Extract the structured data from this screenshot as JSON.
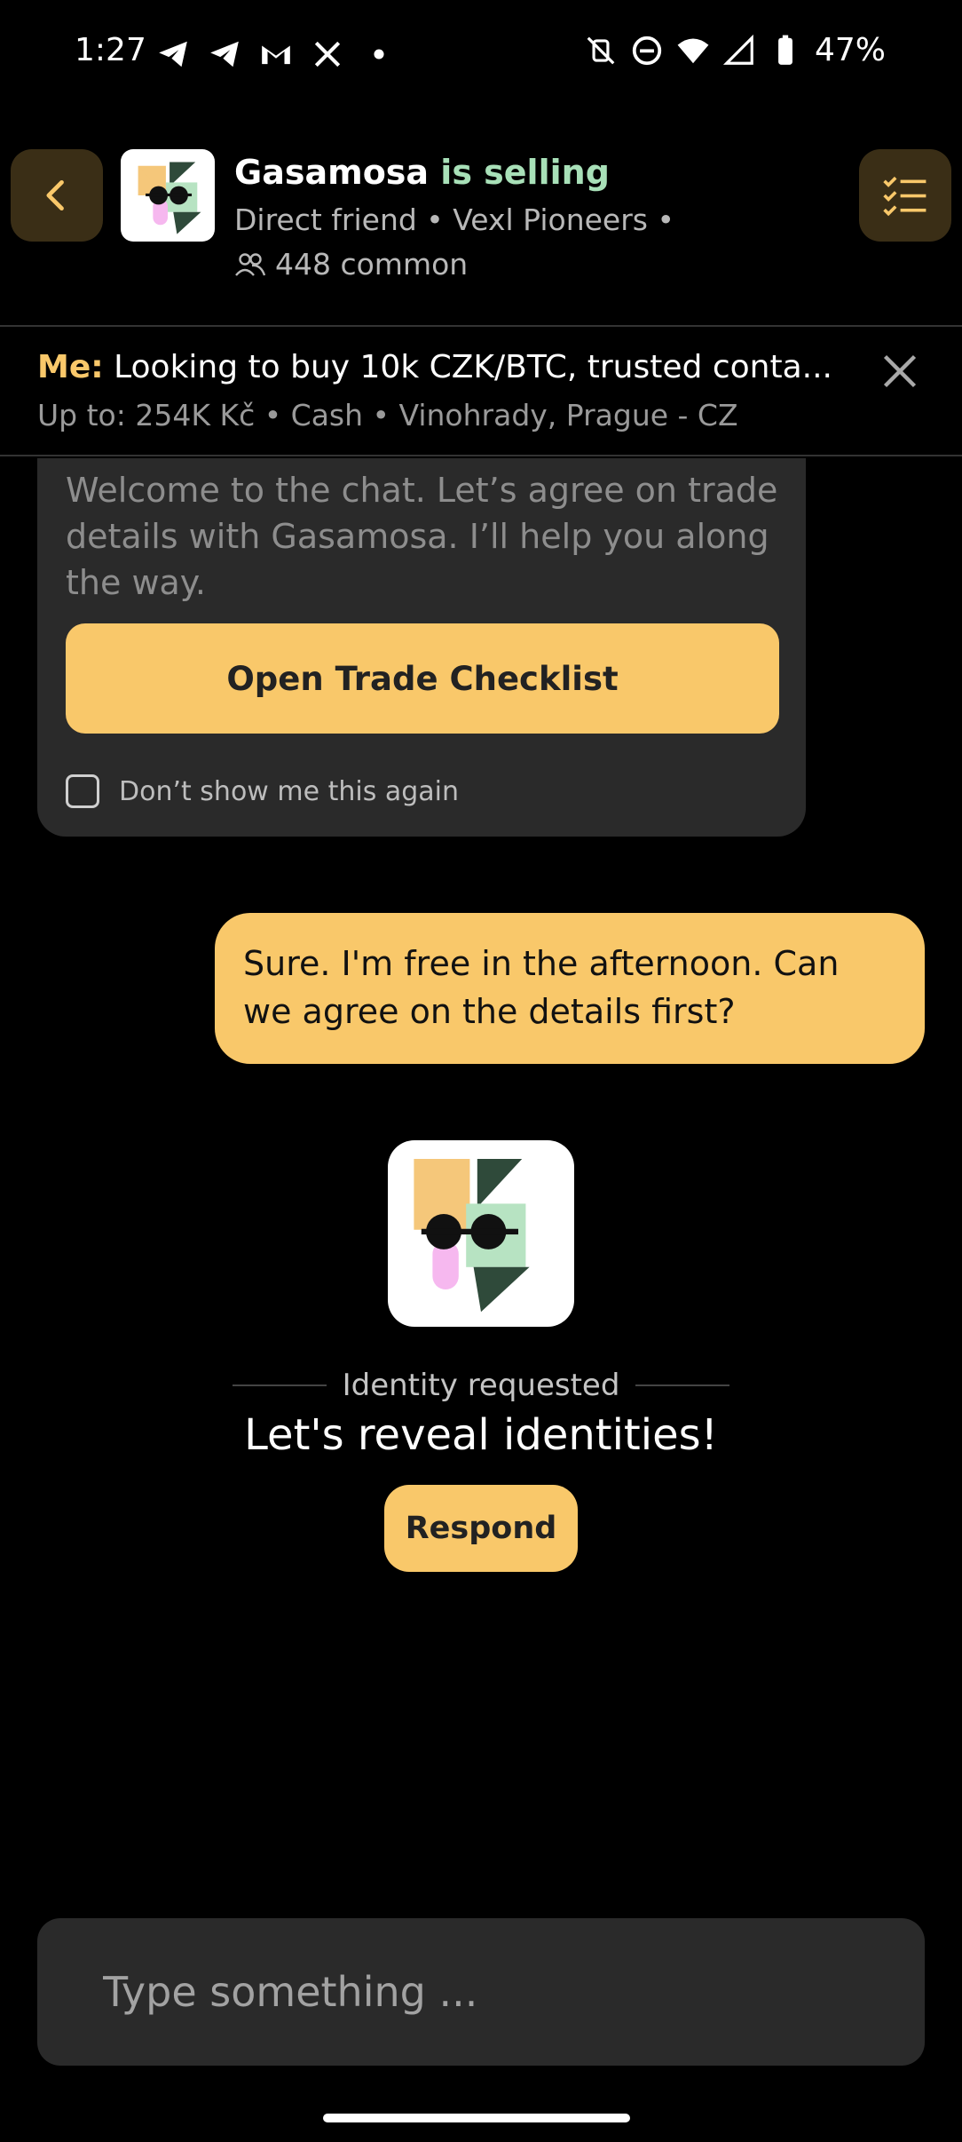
{
  "status_bar": {
    "time": "1:27",
    "battery": "47%",
    "left_icons": [
      "telegram-icon",
      "telegram-icon",
      "gmail-icon",
      "x-icon",
      "dot-icon"
    ],
    "right_icons": [
      "vibrate-off-icon",
      "do-not-disturb-icon",
      "wifi-icon",
      "signal-icon",
      "battery-icon"
    ]
  },
  "header": {
    "name": "Gasamosa",
    "status": "is selling",
    "subtitle": "Direct friend • Vexl Pioneers •",
    "common": "448 common"
  },
  "offer": {
    "me_label": "Me:",
    "text": "Looking to buy 10k CZK/BTC, trusted conta...",
    "details": "Up to: 254K Kč  •  Cash  •  Vinohrady, Prague - CZ"
  },
  "welcome": {
    "text": "Welcome to the chat. Let’s agree on trade details with Gasamosa. I’ll help you along the way.",
    "button_label": "Open Trade Checklist",
    "dont_show_label": "Don’t show me this again"
  },
  "messages": [
    {
      "text": "Sure. I'm free in the afternoon. Can we agree on the details first?"
    }
  ],
  "identity": {
    "label": "Identity requested",
    "title": "Let's reveal identities!",
    "respond_label": "Respond"
  },
  "composer": {
    "placeholder": "Type something ..."
  },
  "colors": {
    "accent": "#f9c86a",
    "selling": "#a8e0b8",
    "card": "#2a2a2a",
    "button_dark": "#3a2e16"
  }
}
